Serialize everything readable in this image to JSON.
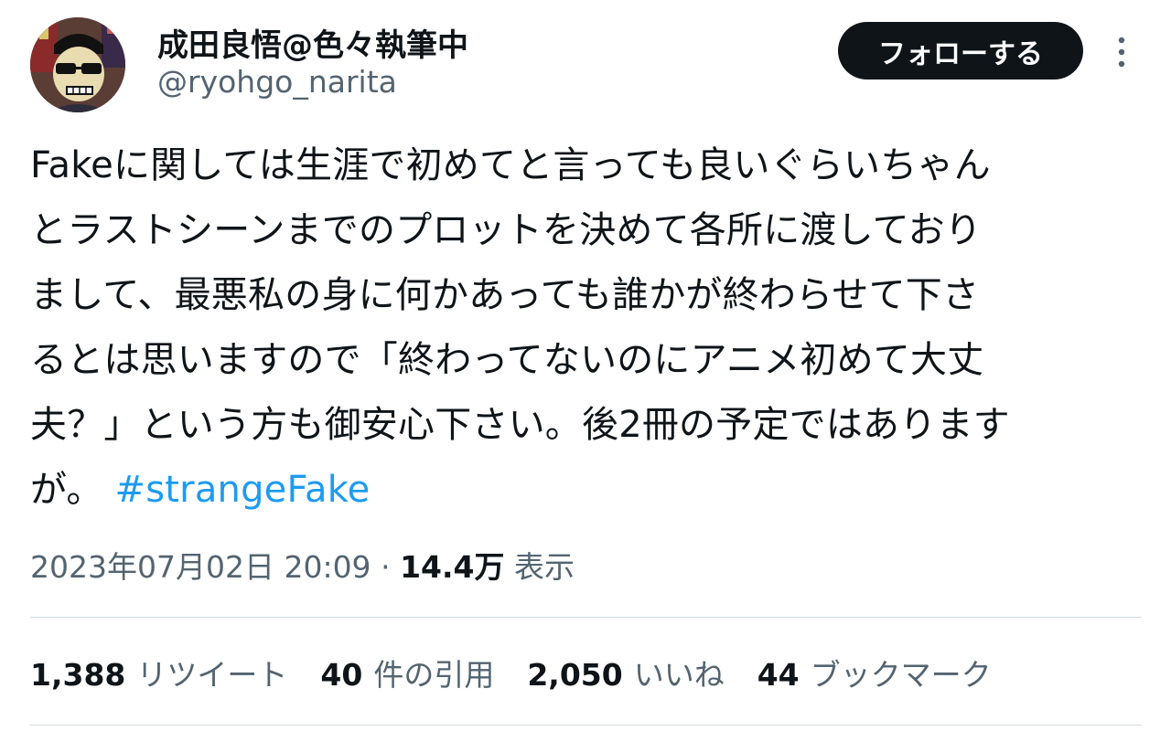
{
  "author": {
    "display_name": "成田良悟@色々執筆中",
    "handle": "@ryohgo_narita"
  },
  "follow_button_label": "フォローする",
  "tweet": {
    "lines": [
      "Fakeに関しては生涯で初めてと言っても良いぐらいちゃん",
      "とラストシーンまでのプロットを決めて各所に渡しており",
      "まして、最悪私の身に何かあっても誰かが終わらせて下さ",
      "るとは思いますので「終わってないのにアニメ初めて大丈",
      "夫？」という方も御安心下さい。後2冊の予定ではあります"
    ],
    "last_line_text": "が。",
    "hashtag": "#strangeFake"
  },
  "meta": {
    "timestamp": "2023年07月02日 20:09",
    "separator": "·",
    "views_count": "14.4万",
    "views_label": "表示"
  },
  "stats": {
    "retweets_count": "1,388",
    "retweets_label": "リツイート",
    "quotes_count": "40",
    "quotes_label": "件の引用",
    "likes_count": "2,050",
    "likes_label": "いいね",
    "bookmarks_count": "44",
    "bookmarks_label": "ブックマーク"
  },
  "colors": {
    "text_primary": "#0f1419",
    "text_secondary": "#536471",
    "link": "#1d9bf0",
    "button_bg": "#0f1419",
    "divider": "#cfd9de"
  },
  "icons": {
    "more": "more-vertical-icon"
  }
}
